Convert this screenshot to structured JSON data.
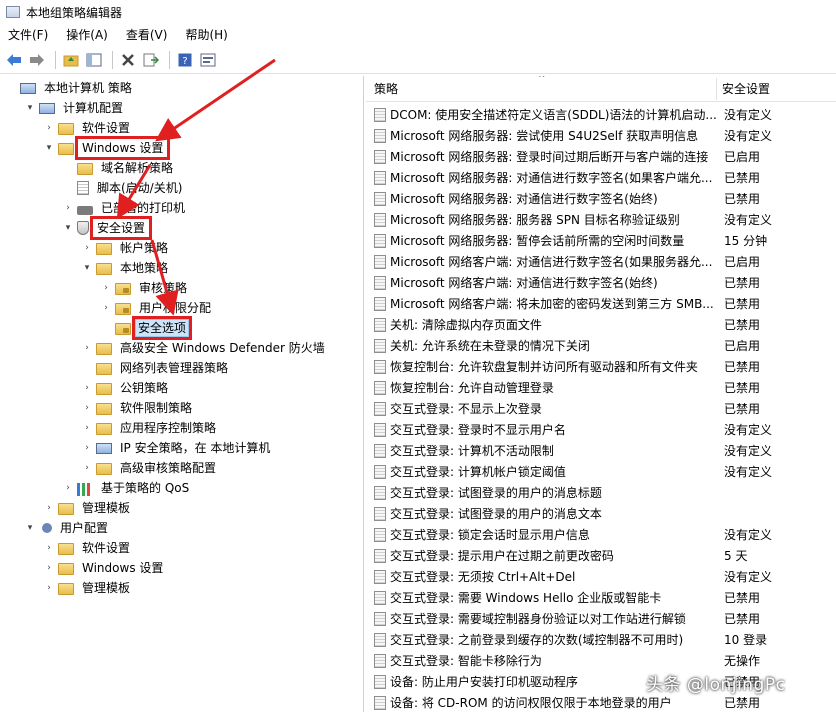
{
  "window": {
    "title": "本地组策略编辑器"
  },
  "menu": [
    "文件(F)",
    "操作(A)",
    "查看(V)",
    "帮助(H)"
  ],
  "toolbar": [
    "back-icon",
    "forward-icon",
    "up-folder-icon",
    "show-hide-tree-icon",
    "delete-icon",
    "export-list-icon",
    "help-icon",
    "properties-icon"
  ],
  "tree": [
    {
      "label": "本地计算机 策略",
      "icon": "policy-icon",
      "exp": ""
    },
    {
      "label": "计算机配置",
      "icon": "computer-icon",
      "exp": "▾"
    },
    {
      "label": "软件设置",
      "icon": "folder-icon",
      "exp": "›"
    },
    {
      "label": "Windows 设置",
      "icon": "folder-icon",
      "exp": "▾"
    },
    {
      "label": "域名解析策略",
      "icon": "folder-icon",
      "exp": ""
    },
    {
      "label": "脚本(启动/关机)",
      "icon": "script-icon",
      "exp": ""
    },
    {
      "label": "已部署的打印机",
      "icon": "printer-icon",
      "exp": "›"
    },
    {
      "label": "安全设置",
      "icon": "shield-icon",
      "exp": "▾"
    },
    {
      "label": "帐户策略",
      "icon": "folder-icon",
      "exp": "›"
    },
    {
      "label": "本地策略",
      "icon": "folder-icon",
      "exp": "▾"
    },
    {
      "label": "审核策略",
      "icon": "folder-lock-icon",
      "exp": "›"
    },
    {
      "label": "用户权限分配",
      "icon": "folder-lock-icon",
      "exp": "›"
    },
    {
      "label": "安全选项",
      "icon": "folder-lock-icon",
      "exp": ""
    },
    {
      "label": "高级安全 Windows Defender 防火墙",
      "icon": "folder-icon",
      "exp": "›"
    },
    {
      "label": "网络列表管理器策略",
      "icon": "folder-icon",
      "exp": ""
    },
    {
      "label": "公钥策略",
      "icon": "folder-icon",
      "exp": "›"
    },
    {
      "label": "软件限制策略",
      "icon": "folder-icon",
      "exp": "›"
    },
    {
      "label": "应用程序控制策略",
      "icon": "folder-icon",
      "exp": "›"
    },
    {
      "label": "IP 安全策略，在 本地计算机",
      "icon": "ip-security-icon",
      "exp": "›"
    },
    {
      "label": "高级审核策略配置",
      "icon": "folder-icon",
      "exp": "›"
    },
    {
      "label": "基于策略的 QoS",
      "icon": "chart-icon",
      "exp": "›"
    },
    {
      "label": "管理模板",
      "icon": "folder-icon",
      "exp": "›"
    },
    {
      "label": "用户配置",
      "icon": "user-icon",
      "exp": "▾"
    },
    {
      "label": "软件设置",
      "icon": "folder-icon",
      "exp": "›"
    },
    {
      "label": "Windows 设置",
      "icon": "folder-icon",
      "exp": "›"
    },
    {
      "label": "管理模板",
      "icon": "folder-icon",
      "exp": "›"
    }
  ],
  "list": {
    "col_policy": "策略",
    "col_setting": "安全设置",
    "rows": [
      {
        "name": "DCOM: 使用安全描述符定义语言(SDDL)语法的计算机启动...",
        "value": "没有定义"
      },
      {
        "name": "Microsoft 网络服务器: 尝试使用 S4U2Self 获取声明信息",
        "value": "没有定义"
      },
      {
        "name": "Microsoft 网络服务器: 登录时间过期后断开与客户端的连接",
        "value": "已启用"
      },
      {
        "name": "Microsoft 网络服务器: 对通信进行数字签名(如果客户端允...",
        "value": "已禁用"
      },
      {
        "name": "Microsoft 网络服务器: 对通信进行数字签名(始终)",
        "value": "已禁用"
      },
      {
        "name": "Microsoft 网络服务器: 服务器 SPN 目标名称验证级别",
        "value": "没有定义"
      },
      {
        "name": "Microsoft 网络服务器: 暂停会话前所需的空闲时间数量",
        "value": "15 分钟"
      },
      {
        "name": "Microsoft 网络客户端: 对通信进行数字签名(如果服务器允...",
        "value": "已启用"
      },
      {
        "name": "Microsoft 网络客户端: 对通信进行数字签名(始终)",
        "value": "已禁用"
      },
      {
        "name": "Microsoft 网络客户端: 将未加密的密码发送到第三方 SMB...",
        "value": "已禁用"
      },
      {
        "name": "关机: 清除虚拟内存页面文件",
        "value": "已禁用"
      },
      {
        "name": "关机: 允许系统在未登录的情况下关闭",
        "value": "已启用"
      },
      {
        "name": "恢复控制台: 允许软盘复制并访问所有驱动器和所有文件夹",
        "value": "已禁用"
      },
      {
        "name": "恢复控制台: 允许自动管理登录",
        "value": "已禁用"
      },
      {
        "name": "交互式登录: 不显示上次登录",
        "value": "已禁用"
      },
      {
        "name": "交互式登录: 登录时不显示用户名",
        "value": "没有定义"
      },
      {
        "name": "交互式登录: 计算机不活动限制",
        "value": "没有定义"
      },
      {
        "name": "交互式登录: 计算机帐户锁定阈值",
        "value": "没有定义"
      },
      {
        "name": "交互式登录: 试图登录的用户的消息标题",
        "value": ""
      },
      {
        "name": "交互式登录: 试图登录的用户的消息文本",
        "value": ""
      },
      {
        "name": "交互式登录: 锁定会话时显示用户信息",
        "value": "没有定义"
      },
      {
        "name": "交互式登录: 提示用户在过期之前更改密码",
        "value": "5 天"
      },
      {
        "name": "交互式登录: 无须按 Ctrl+Alt+Del",
        "value": "没有定义"
      },
      {
        "name": "交互式登录: 需要 Windows Hello 企业版或智能卡",
        "value": "已禁用"
      },
      {
        "name": "交互式登录: 需要域控制器身份验证以对工作站进行解锁",
        "value": "已禁用"
      },
      {
        "name": "交互式登录: 之前登录到缓存的次数(域控制器不可用时)",
        "value": "10 登录"
      },
      {
        "name": "交互式登录: 智能卡移除行为",
        "value": "无操作"
      },
      {
        "name": "设备: 防止用户安装打印机驱动程序",
        "value": "已禁用"
      },
      {
        "name": "设备: 将 CD-ROM 的访问权限仅限于本地登录的用户",
        "value": "已禁用"
      }
    ]
  },
  "watermark": "头条 @lonjingPc",
  "accent": {
    "highlight": "#e02020",
    "selection": "#cce4f7"
  }
}
